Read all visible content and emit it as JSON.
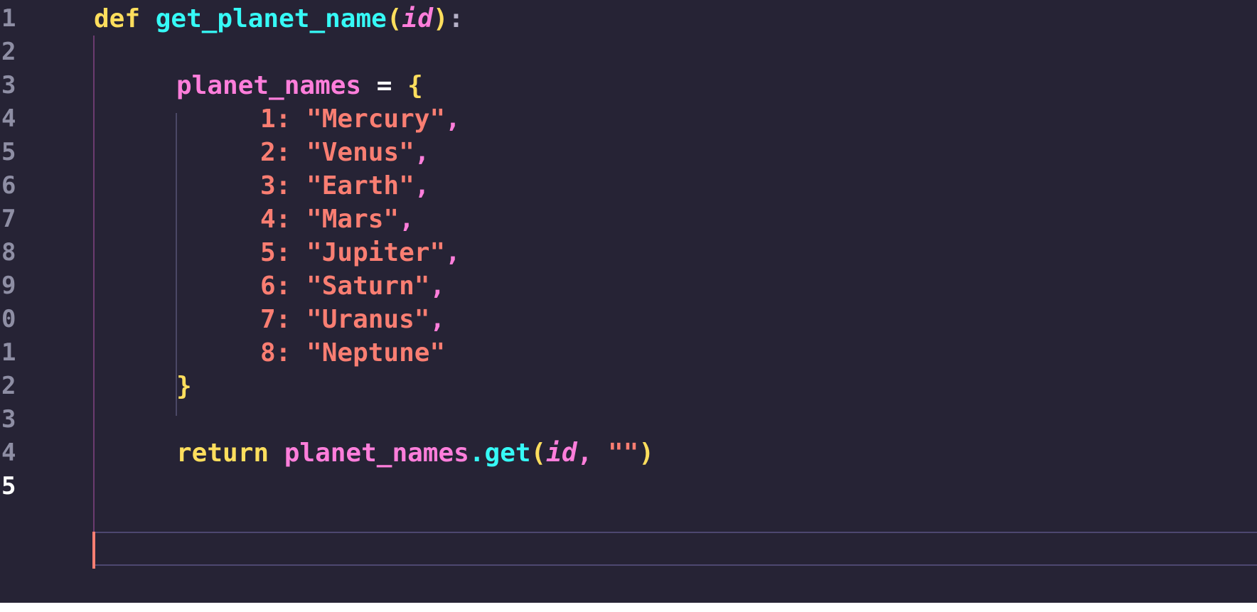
{
  "colors": {
    "background": "#262335",
    "keyword": "#fede5d",
    "function": "#36f9f6",
    "variable": "#ff7edb",
    "string": "#f97e72",
    "line_number": "#8e8ea4",
    "cursor": "#f97e72"
  },
  "gutter": {
    "line_numbers": [
      "1",
      "2",
      "3",
      "4",
      "5",
      "6",
      "7",
      "8",
      "9",
      "0",
      "1",
      "2",
      "3",
      "4",
      "5"
    ]
  },
  "code": {
    "line1": {
      "kw": "def",
      "fn": "get_planet_name",
      "open": "(",
      "param": "id",
      "close": ")",
      "colon": ":"
    },
    "line3": {
      "var": "planet_names",
      "op": "=",
      "brace": "{"
    },
    "entries": [
      {
        "key": "1:",
        "value": "\"Mercury\"",
        "comma": ","
      },
      {
        "key": "2:",
        "value": "\"Venus\"",
        "comma": ","
      },
      {
        "key": "3:",
        "value": "\"Earth\"",
        "comma": ","
      },
      {
        "key": "4:",
        "value": "\"Mars\"",
        "comma": ","
      },
      {
        "key": "5:",
        "value": "\"Jupiter\"",
        "comma": ","
      },
      {
        "key": "6:",
        "value": "\"Saturn\"",
        "comma": ","
      },
      {
        "key": "7:",
        "value": "\"Uranus\"",
        "comma": ","
      },
      {
        "key": "8:",
        "value": "\"Neptune\"",
        "comma": ""
      }
    ],
    "line12": {
      "brace": "}"
    },
    "line14": {
      "kw": "return",
      "var": "planet_names",
      "dot": ".",
      "method": "get",
      "open": "(",
      "param": "id",
      "comma": ",",
      "str": "\"\"",
      "close": ")"
    }
  }
}
